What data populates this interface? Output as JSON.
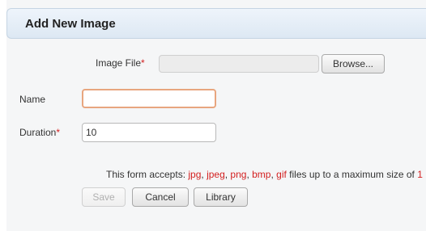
{
  "dialog": {
    "title": "Add New Image"
  },
  "form": {
    "image_file": {
      "label": "Image File",
      "required_mark": "*",
      "value": "",
      "browse_label": "Browse..."
    },
    "name": {
      "label": "Name",
      "value": ""
    },
    "duration": {
      "label": "Duration",
      "required_mark": "*",
      "value": "10"
    },
    "hint": {
      "prefix": "This form accepts: ",
      "formats": [
        "jpg",
        "jpeg",
        "png",
        "bmp",
        "gif"
      ],
      "separators": [
        ", ",
        ", ",
        ", ",
        ", "
      ],
      "suffix": " files up to a maximum size of ",
      "cut_off": "1"
    }
  },
  "buttons": {
    "save": "Save",
    "cancel": "Cancel",
    "library": "Library"
  },
  "colors": {
    "required": "#d31f1f",
    "focus_border": "#e8a67f",
    "header_bg": "#dde8f3"
  }
}
